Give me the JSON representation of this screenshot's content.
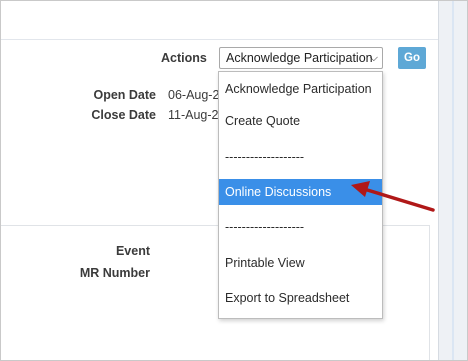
{
  "header": {
    "actions_label": "Actions",
    "actions_select_value": "Acknowledge Participation",
    "go_label": "Go"
  },
  "details": {
    "open_date_label": "Open Date",
    "open_date_value": "06-Aug-2",
    "close_date_label": "Close Date",
    "close_date_value": "11-Aug-2"
  },
  "lower": {
    "event_label": "Event",
    "mr_number_label": "MR Number"
  },
  "dropdown": {
    "items": [
      {
        "label": "Acknowledge Participation",
        "selected": false
      },
      {
        "label": "Create Quote",
        "selected": false
      },
      {
        "label": "-------------------",
        "selected": false
      },
      {
        "label": "Online Discussions",
        "selected": true
      },
      {
        "label": "-------------------",
        "selected": false
      },
      {
        "label": "Printable View",
        "selected": false
      },
      {
        "label": "Export to Spreadsheet",
        "selected": false
      }
    ]
  },
  "colors": {
    "highlight": "#3a8fe8",
    "go_button": "#5ea8d6",
    "annotation_arrow": "#b01818"
  }
}
